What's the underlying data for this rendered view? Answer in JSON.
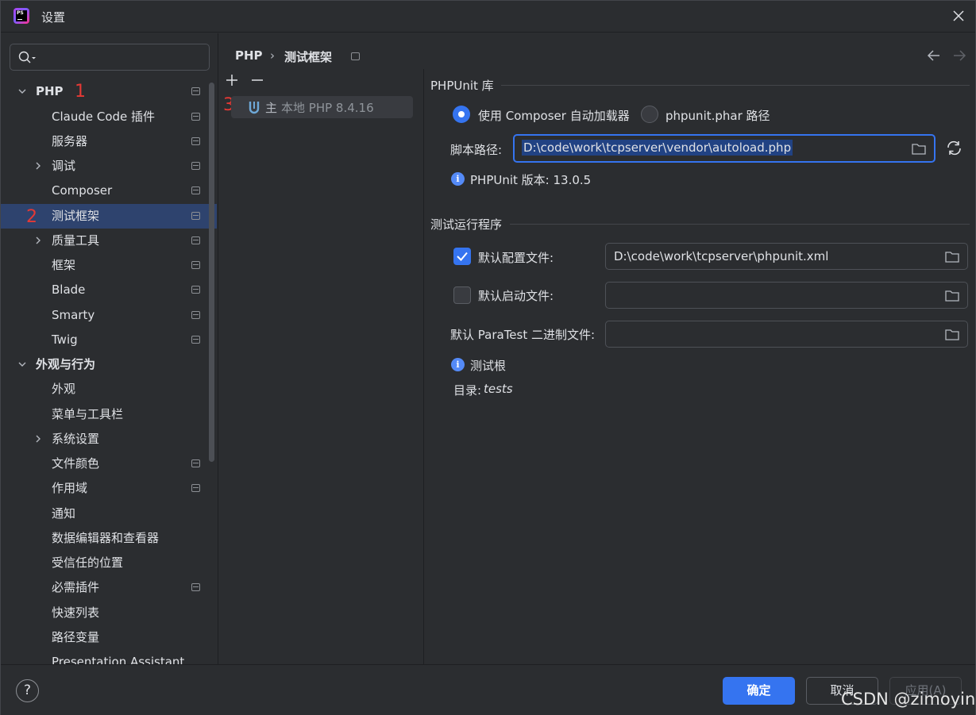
{
  "window": {
    "title": "设置"
  },
  "search": {
    "placeholder": ""
  },
  "sidebar": {
    "items": [
      {
        "label": "PHP"
      },
      {
        "label": "Claude Code 插件"
      },
      {
        "label": "服务器"
      },
      {
        "label": "调试"
      },
      {
        "label": "Composer"
      },
      {
        "label": "测试框架"
      },
      {
        "label": "质量工具"
      },
      {
        "label": "框架"
      },
      {
        "label": "Blade"
      },
      {
        "label": "Smarty"
      },
      {
        "label": "Twig"
      },
      {
        "label": "外观与行为"
      },
      {
        "label": "外观"
      },
      {
        "label": "菜单与工具栏"
      },
      {
        "label": "系统设置"
      },
      {
        "label": "文件颜色"
      },
      {
        "label": "作用域"
      },
      {
        "label": "通知"
      },
      {
        "label": "数据编辑器和查看器"
      },
      {
        "label": "受信任的位置"
      },
      {
        "label": "必需插件"
      },
      {
        "label": "快速列表"
      },
      {
        "label": "路径变量"
      },
      {
        "label": "Presentation Assistant"
      }
    ]
  },
  "annotations": {
    "a1": "1",
    "a2": "2",
    "a3": "3"
  },
  "breadcrumb": {
    "root": "PHP",
    "sep": "›",
    "current": "测试框架"
  },
  "middle": {
    "items": [
      {
        "tag": "主",
        "label": "本地 PHP 8.4.16"
      }
    ]
  },
  "phpunit": {
    "section_title": "PHPUnit 库",
    "radio_composer": "使用 Composer 自动加载器",
    "radio_phar": "phpunit.phar 路径",
    "script_path_label": "脚本路径:",
    "script_path_value": "D:\\code\\work\\tcpserver\\vendor\\autoload.php",
    "version_text": "PHPUnit 版本: 13.0.5"
  },
  "runner": {
    "section_title": "测试运行程序",
    "default_config_label": "默认配置文件:",
    "default_config_value": "D:\\code\\work\\tcpserver\\phpunit.xml",
    "default_bootstrap_label": "默认启动文件:",
    "default_bootstrap_value": "",
    "paratest_label": "默认 ParaTest 二进制文件:",
    "paratest_value": "",
    "test_root_label": "测试根",
    "dir_label": "目录:",
    "dir_value": "tests"
  },
  "buttons": {
    "ok": "确定",
    "cancel": "取消",
    "apply": "应用(A)",
    "help": "?"
  },
  "watermark": "CSDN @zimoyin",
  "colors": {
    "accent": "#3574f0",
    "selection": "#2e436e",
    "annotation": "#e53935",
    "background": "#2b2d30"
  }
}
